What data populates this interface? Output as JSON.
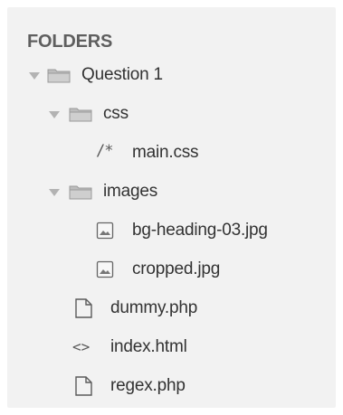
{
  "sidebar": {
    "header": "FOLDERS",
    "items": [
      {
        "label": "Question 1",
        "type": "folder",
        "expanded": true
      },
      {
        "label": "css",
        "type": "folder",
        "expanded": true
      },
      {
        "label": "main.css",
        "type": "file",
        "icon_glyph": "/*"
      },
      {
        "label": "images",
        "type": "folder",
        "expanded": true
      },
      {
        "label": "bg-heading-03.jpg",
        "type": "image"
      },
      {
        "label": "cropped.jpg",
        "type": "image"
      },
      {
        "label": "dummy.php",
        "type": "file"
      },
      {
        "label": "index.html",
        "type": "file",
        "icon_glyph": "<>"
      },
      {
        "label": "regex.php",
        "type": "file"
      }
    ]
  }
}
